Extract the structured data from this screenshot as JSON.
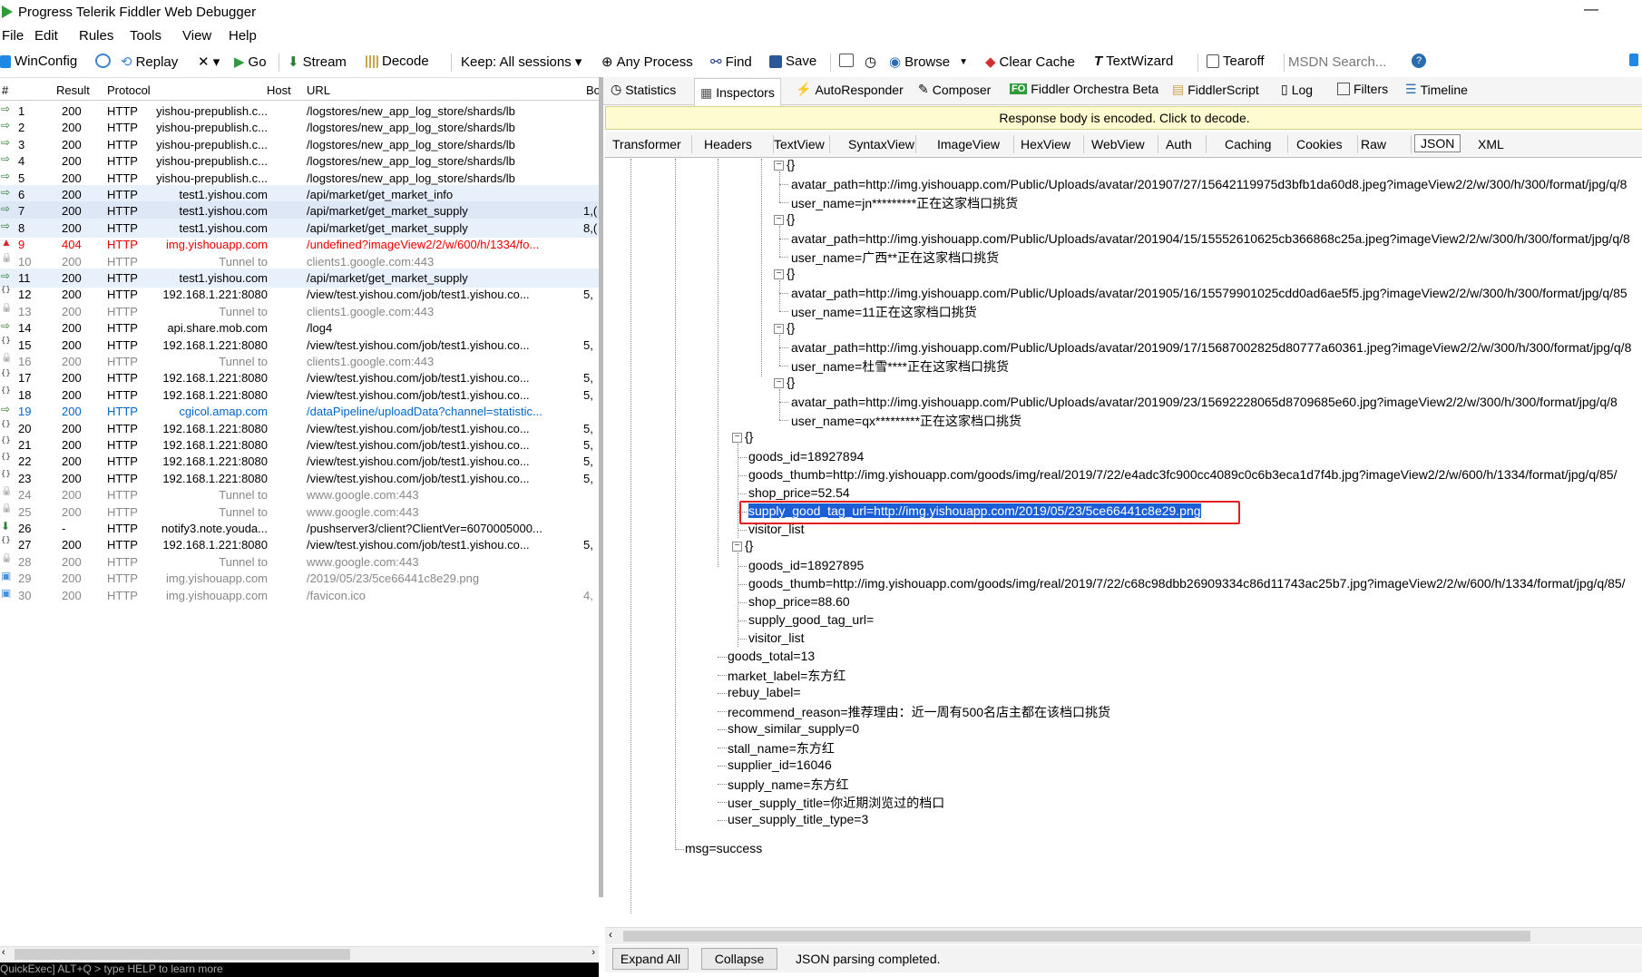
{
  "window": {
    "title": "Progress Telerik Fiddler Web Debugger",
    "minimize": "—"
  },
  "menu": [
    "File",
    "Edit",
    "Rules",
    "Tools",
    "View",
    "Help"
  ],
  "toolbar": {
    "winconfig": "WinConfig",
    "replay": "Replay",
    "remove": "✕ ▾",
    "go": "Go",
    "stream": "Stream",
    "decode": "Decode",
    "keep": "Keep: All sessions ▾",
    "any_process": "Any Process",
    "find": "Find",
    "save": "Save",
    "browse": "Browse",
    "clear_cache": "Clear Cache",
    "textwizard": "TextWizard",
    "tearoff": "Tearoff",
    "msdn_search": "MSDN Search..."
  },
  "sessions": {
    "columns": [
      "#",
      "Result",
      "Protocol",
      "Host",
      "URL",
      "Bo"
    ],
    "rows": [
      {
        "id": "1",
        "result": "200",
        "protocol": "HTTP",
        "host": "yishou-prepublish.c...",
        "url": "/logstores/new_app_log_store/shards/lb",
        "body": "",
        "style": "",
        "icon": "arrow"
      },
      {
        "id": "2",
        "result": "200",
        "protocol": "HTTP",
        "host": "yishou-prepublish.c...",
        "url": "/logstores/new_app_log_store/shards/lb",
        "body": "",
        "style": "",
        "icon": "arrow"
      },
      {
        "id": "3",
        "result": "200",
        "protocol": "HTTP",
        "host": "yishou-prepublish.c...",
        "url": "/logstores/new_app_log_store/shards/lb",
        "body": "",
        "style": "",
        "icon": "arrow"
      },
      {
        "id": "4",
        "result": "200",
        "protocol": "HTTP",
        "host": "yishou-prepublish.c...",
        "url": "/logstores/new_app_log_store/shards/lb",
        "body": "",
        "style": "",
        "icon": "arrow"
      },
      {
        "id": "5",
        "result": "200",
        "protocol": "HTTP",
        "host": "yishou-prepublish.c...",
        "url": "/logstores/new_app_log_store/shards/lb",
        "body": "",
        "style": "",
        "icon": "arrow"
      },
      {
        "id": "6",
        "result": "200",
        "protocol": "HTTP",
        "host": "test1.yishou.com",
        "url": "/api/market/get_market_info",
        "body": "",
        "style": "hl",
        "icon": "arrow"
      },
      {
        "id": "7",
        "result": "200",
        "protocol": "HTTP",
        "host": "test1.yishou.com",
        "url": "/api/market/get_market_supply",
        "body": "1,(",
        "style": "hl2",
        "icon": "arrow"
      },
      {
        "id": "8",
        "result": "200",
        "protocol": "HTTP",
        "host": "test1.yishou.com",
        "url": "/api/market/get_market_supply",
        "body": "8,(",
        "style": "hl",
        "icon": "arrow"
      },
      {
        "id": "9",
        "result": "404",
        "protocol": "HTTP",
        "host": "img.yishouapp.com",
        "url": "/undefined?imageView2/2/w/600/h/1334/fo...",
        "body": "",
        "style": "red",
        "icon": "warn"
      },
      {
        "id": "10",
        "result": "200",
        "protocol": "HTTP",
        "host": "Tunnel to",
        "url": "clients1.google.com:443",
        "body": "",
        "style": "gray",
        "icon": "lock"
      },
      {
        "id": "11",
        "result": "200",
        "protocol": "HTTP",
        "host": "test1.yishou.com",
        "url": "/api/market/get_market_supply",
        "body": "",
        "style": "hl",
        "icon": "arrow"
      },
      {
        "id": "12",
        "result": "200",
        "protocol": "HTTP",
        "host": "192.168.1.221:8080",
        "url": "/view/test.yishou.com/job/test1.yishou.co...",
        "body": "5,",
        "style": "",
        "icon": "js"
      },
      {
        "id": "13",
        "result": "200",
        "protocol": "HTTP",
        "host": "Tunnel to",
        "url": "clients1.google.com:443",
        "body": "",
        "style": "gray",
        "icon": "lock"
      },
      {
        "id": "14",
        "result": "200",
        "protocol": "HTTP",
        "host": "api.share.mob.com",
        "url": "/log4",
        "body": "",
        "style": "",
        "icon": "arrow"
      },
      {
        "id": "15",
        "result": "200",
        "protocol": "HTTP",
        "host": "192.168.1.221:8080",
        "url": "/view/test.yishou.com/job/test1.yishou.co...",
        "body": "5,",
        "style": "",
        "icon": "js"
      },
      {
        "id": "16",
        "result": "200",
        "protocol": "HTTP",
        "host": "Tunnel to",
        "url": "clients1.google.com:443",
        "body": "",
        "style": "gray",
        "icon": "lock"
      },
      {
        "id": "17",
        "result": "200",
        "protocol": "HTTP",
        "host": "192.168.1.221:8080",
        "url": "/view/test.yishou.com/job/test1.yishou.co...",
        "body": "5,",
        "style": "",
        "icon": "js"
      },
      {
        "id": "18",
        "result": "200",
        "protocol": "HTTP",
        "host": "192.168.1.221:8080",
        "url": "/view/test.yishou.com/job/test1.yishou.co...",
        "body": "5,",
        "style": "",
        "icon": "js"
      },
      {
        "id": "19",
        "result": "200",
        "protocol": "HTTP",
        "host": "cgicol.amap.com",
        "url": "/dataPipeline/uploadData?channel=statistic...",
        "body": "",
        "style": "blue",
        "icon": "arrow"
      },
      {
        "id": "20",
        "result": "200",
        "protocol": "HTTP",
        "host": "192.168.1.221:8080",
        "url": "/view/test.yishou.com/job/test1.yishou.co...",
        "body": "5,",
        "style": "",
        "icon": "js"
      },
      {
        "id": "21",
        "result": "200",
        "protocol": "HTTP",
        "host": "192.168.1.221:8080",
        "url": "/view/test.yishou.com/job/test1.yishou.co...",
        "body": "5,",
        "style": "",
        "icon": "js"
      },
      {
        "id": "22",
        "result": "200",
        "protocol": "HTTP",
        "host": "192.168.1.221:8080",
        "url": "/view/test.yishou.com/job/test1.yishou.co...",
        "body": "5,",
        "style": "",
        "icon": "js"
      },
      {
        "id": "23",
        "result": "200",
        "protocol": "HTTP",
        "host": "192.168.1.221:8080",
        "url": "/view/test.yishou.com/job/test1.yishou.co...",
        "body": "5,",
        "style": "",
        "icon": "js"
      },
      {
        "id": "24",
        "result": "200",
        "protocol": "HTTP",
        "host": "Tunnel to",
        "url": "www.google.com:443",
        "body": "",
        "style": "gray",
        "icon": "lock"
      },
      {
        "id": "25",
        "result": "200",
        "protocol": "HTTP",
        "host": "Tunnel to",
        "url": "www.google.com:443",
        "body": "",
        "style": "gray",
        "icon": "lock"
      },
      {
        "id": "26",
        "result": "-",
        "protocol": "HTTP",
        "host": "notify3.note.youda...",
        "url": "/pushserver3/client?ClientVer=6070005000...",
        "body": "",
        "style": "",
        "icon": "down"
      },
      {
        "id": "27",
        "result": "200",
        "protocol": "HTTP",
        "host": "192.168.1.221:8080",
        "url": "/view/test.yishou.com/job/test1.yishou.co...",
        "body": "5,",
        "style": "",
        "icon": "js"
      },
      {
        "id": "28",
        "result": "200",
        "protocol": "HTTP",
        "host": "Tunnel to",
        "url": "www.google.com:443",
        "body": "",
        "style": "gray",
        "icon": "lock"
      },
      {
        "id": "29",
        "result": "200",
        "protocol": "HTTP",
        "host": "img.yishouapp.com",
        "url": "/2019/05/23/5ce66441c8e29.png",
        "body": "",
        "style": "gray",
        "icon": "img"
      },
      {
        "id": "30",
        "result": "200",
        "protocol": "HTTP",
        "host": "img.yishouapp.com",
        "url": "/favicon.ico",
        "body": "4,",
        "style": "gray",
        "icon": "img"
      }
    ],
    "quickexec": "QuickExec] ALT+Q > type HELP to learn more"
  },
  "inspector_tabs": [
    "Statistics",
    "Inspectors",
    "AutoResponder",
    "Composer",
    "Fiddler Orchestra Beta",
    "FiddlerScript",
    "Log",
    "Filters",
    "Timeline"
  ],
  "notice": "Response body is encoded. Click to decode.",
  "response_tabs": [
    "Transformer",
    "Headers",
    "TextView",
    "SyntaxView",
    "ImageView",
    "HexView",
    "WebView",
    "Auth",
    "Caching",
    "Cookies",
    "Raw",
    "JSON",
    "XML"
  ],
  "tree": {
    "visitors": [
      {
        "avatar": "avatar_path=http://img.yishouapp.com/Public/Uploads/avatar/201907/27/15642119975d3bfb1da60d8.jpeg?imageView2/2/w/300/h/300/format/jpg/q/8",
        "user": "user_name=jn*********正在这家档口挑货"
      },
      {
        "avatar": "avatar_path=http://img.yishouapp.com/Public/Uploads/avatar/201904/15/15552610625cb366868c25a.jpeg?imageView2/2/w/300/h/300/format/jpg/q/8",
        "user": "user_name=广西**正在这家档口挑货"
      },
      {
        "avatar": "avatar_path=http://img.yishouapp.com/Public/Uploads/avatar/201905/16/15579901025cdd0ad6ae5f5.jpg?imageView2/2/w/300/h/300/format/jpg/q/85",
        "user": "user_name=11正在这家档口挑货"
      },
      {
        "avatar": "avatar_path=http://img.yishouapp.com/Public/Uploads/avatar/201909/17/15687002825d80777a60361.jpeg?imageView2/2/w/300/h/300/format/jpg/q/8",
        "user": "user_name=杜雪****正在这家档口挑货"
      },
      {
        "avatar": "avatar_path=http://img.yishouapp.com/Public/Uploads/avatar/201909/23/15692228065d8709685e60.jpg?imageView2/2/w/300/h/300/format/jpg/q/8",
        "user": "user_name=qx*********正在这家档口挑货"
      }
    ],
    "goods1": [
      "goods_id=18927894",
      "goods_thumb=http://img.yishouapp.com/goods/img/real/2019/7/22/e4adc3fc900cc4089c0c6b3eca1d7f4b.jpg?imageView2/2/w/600/h/1334/format/jpg/q/85/",
      "shop_price=52.54",
      "supply_good_tag_url=http://img.yishouapp.com/2019/05/23/5ce66441c8e29.png",
      "visitor_list"
    ],
    "goods2": [
      "goods_id=18927895",
      "goods_thumb=http://img.yishouapp.com/goods/img/real/2019/7/22/c68c98dbb26909334c86d11743ac25b7.jpg?imageView2/2/w/600/h/1334/format/jpg/q/85/",
      "shop_price=88.60",
      "supply_good_tag_url=",
      "visitor_list"
    ],
    "fields": [
      "goods_total=13",
      "market_label=东方红",
      "rebuy_label=",
      "recommend_reason=推荐理由：近一周有500名店主都在该档口挑货",
      "show_similar_supply=0",
      "stall_name=东方红",
      "supplier_id=16046",
      "supply_name=东方红",
      "user_supply_title=你近期浏览过的档口",
      "user_supply_title_type=3"
    ],
    "msg": "msg=success"
  },
  "bottom": {
    "expand_all": "Expand All",
    "collapse": "Collapse",
    "status": "JSON parsing completed."
  },
  "colors": {
    "selection": "#1b5fd6",
    "highlight_box": "#e02020",
    "notice_bg": "#fffbd0",
    "error_row": "#ee0000",
    "info_row": "#0066cc"
  }
}
